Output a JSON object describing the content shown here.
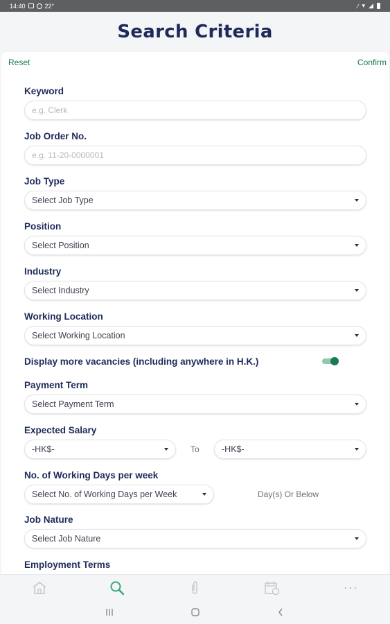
{
  "status_bar": {
    "time": "14:40",
    "temp": "22°"
  },
  "header": {
    "title": "Search Criteria"
  },
  "actions": {
    "reset": "Reset",
    "confirm": "Confirm"
  },
  "fields": {
    "keyword": {
      "label": "Keyword",
      "placeholder": "e.g. Clerk"
    },
    "job_order": {
      "label": "Job Order No.",
      "placeholder": "e.g. 11-20-0000001"
    },
    "job_type": {
      "label": "Job Type",
      "value": "Select Job Type"
    },
    "position": {
      "label": "Position",
      "value": "Select Position"
    },
    "industry": {
      "label": "Industry",
      "value": "Select Industry"
    },
    "working_location": {
      "label": "Working Location",
      "value": "Select Working Location"
    },
    "display_more": {
      "label": "Display more vacancies (including anywhere in H.K.)",
      "enabled": true
    },
    "payment_term": {
      "label": "Payment Term",
      "value": "Select Payment Term"
    },
    "expected_salary": {
      "label": "Expected Salary",
      "from": "-HK$-",
      "to_label": "To",
      "to": "-HK$-"
    },
    "working_days": {
      "label": "No. of Working Days per week",
      "value": "Select No. of Working Days per Week",
      "suffix": "Day(s) Or Below"
    },
    "job_nature": {
      "label": "Job Nature",
      "value": "Select Job Nature"
    },
    "employment_terms": {
      "label": "Employment Terms"
    }
  },
  "bottom_nav": {
    "items": [
      {
        "icon": "home-icon",
        "active": false
      },
      {
        "icon": "search-icon",
        "active": true
      },
      {
        "icon": "paperclip-icon",
        "active": false
      },
      {
        "icon": "calendar-icon",
        "active": false
      },
      {
        "icon": "more-icon",
        "active": false
      }
    ]
  },
  "colors": {
    "accent": "#1b7a53",
    "title": "#1e2a5a",
    "active_nav": "#37a77d",
    "inactive_nav": "#c3c5c9"
  }
}
